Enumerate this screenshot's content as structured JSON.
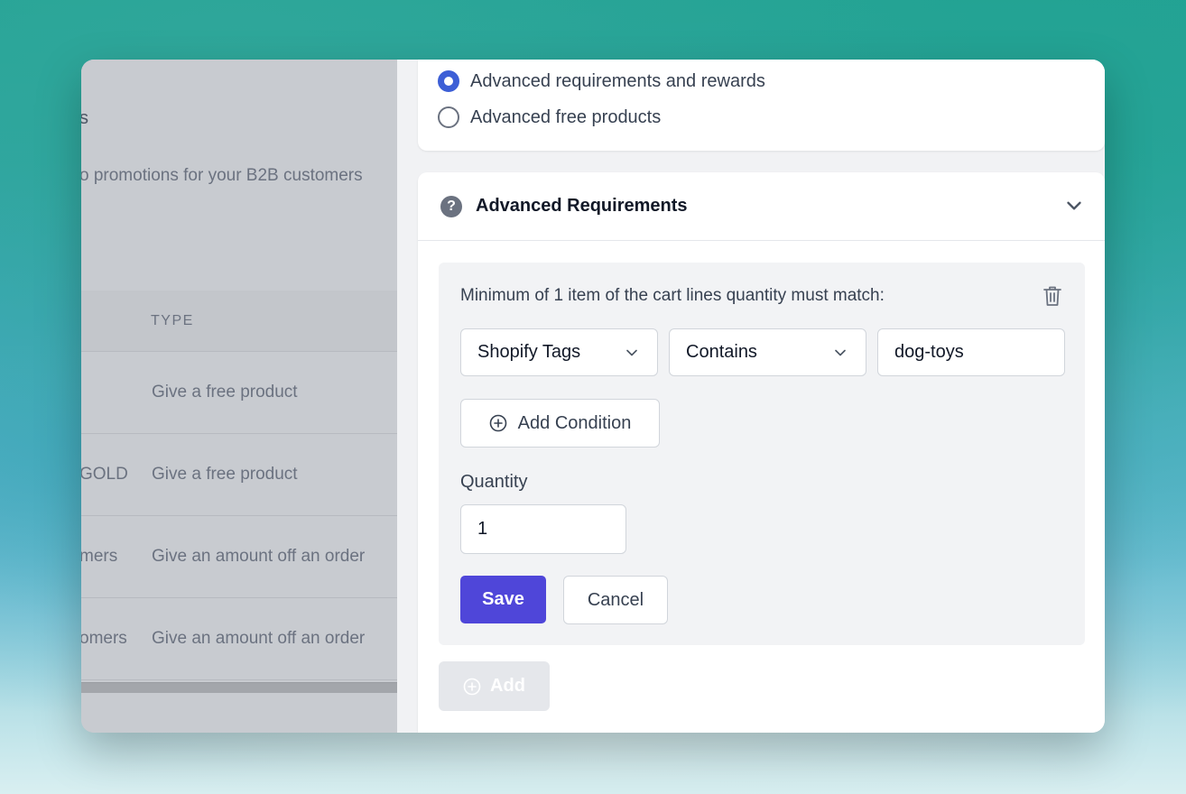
{
  "background_page": {
    "title_fragment": "s",
    "description": "o promotions for your B2B customers",
    "table": {
      "type_header": "TYPE",
      "rows": [
        {
          "name": "",
          "type": "Give a free product"
        },
        {
          "name": "GOLD",
          "type": "Give a free product"
        },
        {
          "name": "mers",
          "type": "Give an amount off an order"
        },
        {
          "name": "omers",
          "type": "Give an amount off an order"
        }
      ]
    }
  },
  "drawer": {
    "options": [
      {
        "label": "Advanced requirements and rewards",
        "selected": true
      },
      {
        "label": "Advanced free products",
        "selected": false
      }
    ],
    "section": {
      "title": "Advanced Requirements",
      "requirement_text": "Minimum of 1 item of the cart lines quantity must match:",
      "condition": {
        "field": "Shopify Tags",
        "operator": "Contains",
        "value": "dog-toys"
      },
      "add_condition_label": "Add Condition",
      "quantity_label": "Quantity",
      "quantity_value": "1",
      "save_label": "Save",
      "cancel_label": "Cancel"
    },
    "add_label": "Add"
  },
  "colors": {
    "primary": "#4f46d9",
    "radio_selected": "#3d5fd6"
  }
}
